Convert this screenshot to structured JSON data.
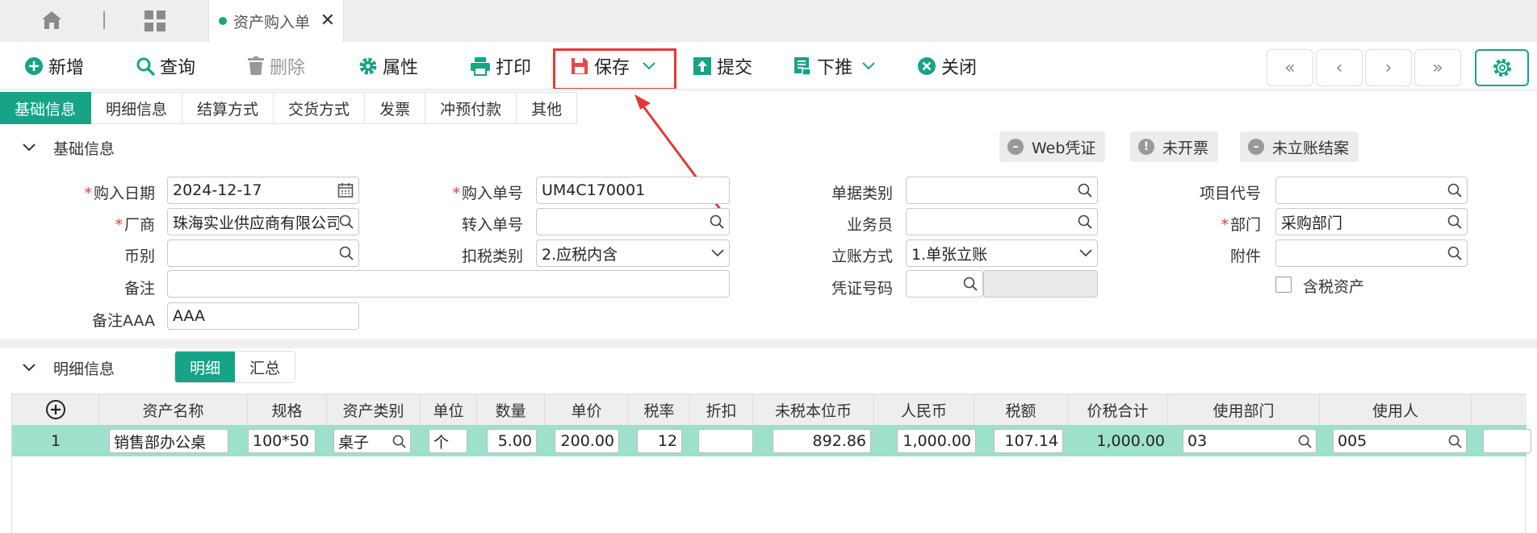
{
  "tabs": {
    "active_label": "资产购入单"
  },
  "toolbar": {
    "new_label": "新增",
    "query_label": "查询",
    "delete_label": "删除",
    "props_label": "属性",
    "print_label": "打印",
    "save_label": "保存",
    "submit_label": "提交",
    "pushdown_label": "下推",
    "close_label": "关闭",
    "nav": {
      "first": "«",
      "prev": "‹",
      "next": "›",
      "last": "»"
    }
  },
  "subtabs": [
    "基础信息",
    "明细信息",
    "结算方式",
    "交货方式",
    "发票",
    "冲预付款",
    "其他"
  ],
  "basic": {
    "title": "基础信息",
    "status": {
      "web_voucher": "Web凭证",
      "not_invoiced": "未开票",
      "not_settled": "未立账结案"
    },
    "labels": {
      "purchase_date": "购入日期",
      "purchase_no": "购入单号",
      "doc_type": "单据类别",
      "project_code": "项目代号",
      "vendor": "厂商",
      "transfer_no": "转入单号",
      "salesman": "业务员",
      "dept": "部门",
      "currency": "币别",
      "tax_type": "扣税类别",
      "account_method": "立账方式",
      "attachment": "附件",
      "remark": "备注",
      "voucher_no": "凭证号码",
      "tax_included": "含税资产",
      "remark_aaa": "备注AAA"
    },
    "values": {
      "purchase_date": "2024-12-17",
      "purchase_no": "UM4C170001",
      "doc_type": "",
      "project_code": "",
      "vendor": "珠海实业供应商有限公司",
      "transfer_no": "",
      "salesman": "",
      "dept": "采购部门",
      "currency": "",
      "tax_type": "2.应税内含",
      "account_method": "1.单张立账",
      "attachment": "",
      "remark": "",
      "voucher_no": "",
      "remark_aaa": "AAA"
    }
  },
  "detail": {
    "title": "明细信息",
    "seg": {
      "detail": "明细",
      "summary": "汇总"
    },
    "columns": [
      "资产名称",
      "规格",
      "资产类别",
      "单位",
      "数量",
      "单价",
      "税率",
      "折扣",
      "未税本位币",
      "人民币",
      "税额",
      "价税合计",
      "使用部门",
      "使用人"
    ],
    "rows": [
      {
        "index": "1",
        "asset_name": "销售部办公桌",
        "spec": "100*50",
        "category": "桌子",
        "unit": "个",
        "qty": "5.00",
        "price": "200.00",
        "tax_rate": "12",
        "discount": "",
        "untaxed": "892.86",
        "rmb": "1,000.00",
        "tax": "107.14",
        "total": "1,000.00",
        "use_dept": "03",
        "user": "005"
      }
    ]
  },
  "colors": {
    "accent": "#16a386",
    "highlight_row": "#9de1cc",
    "callout_red": "#e53935"
  }
}
